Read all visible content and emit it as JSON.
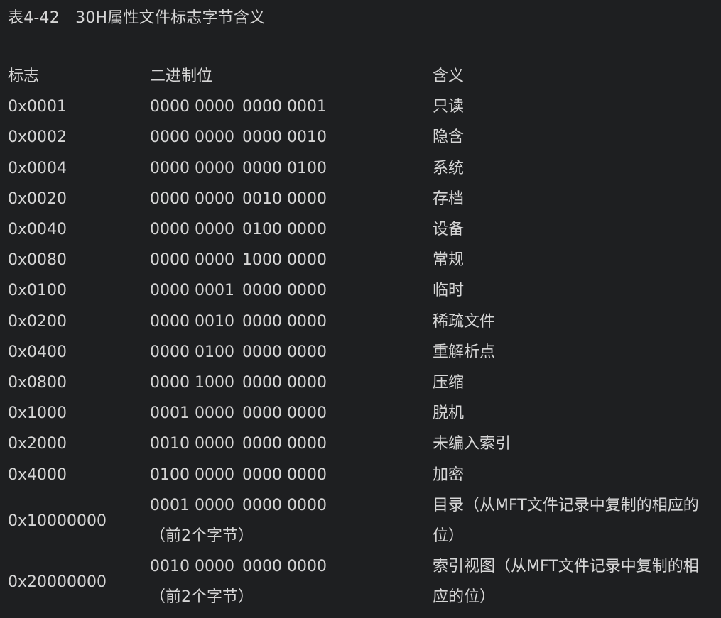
{
  "caption": "表4-42　30H属性文件标志字节含义",
  "table": {
    "headers": [
      "标志",
      "二进制位",
      "含义"
    ],
    "rows": [
      {
        "flag": "0x0001",
        "bin_hi": "0000 0000",
        "bin_lo": "0000 0001",
        "meaning": "只读"
      },
      {
        "flag": "0x0002",
        "bin_hi": "0000 0000",
        "bin_lo": "0000 0010",
        "meaning": "隐含"
      },
      {
        "flag": "0x0004",
        "bin_hi": "0000 0000",
        "bin_lo": "0000 0100",
        "meaning": "系统"
      },
      {
        "flag": "0x0020",
        "bin_hi": "0000 0000",
        "bin_lo": "0010 0000",
        "meaning": "存档"
      },
      {
        "flag": "0x0040",
        "bin_hi": "0000 0000",
        "bin_lo": "0100 0000",
        "meaning": "设备"
      },
      {
        "flag": "0x0080",
        "bin_hi": "0000 0000",
        "bin_lo": "1000 0000",
        "meaning": "常规"
      },
      {
        "flag": "0x0100",
        "bin_hi": "0000 0001",
        "bin_lo": "0000 0000",
        "meaning": "临时"
      },
      {
        "flag": "0x0200",
        "bin_hi": "0000 0010",
        "bin_lo": "0000 0000",
        "meaning": "稀疏文件"
      },
      {
        "flag": "0x0400",
        "bin_hi": "0000 0100",
        "bin_lo": "0000 0000",
        "meaning": "重解析点"
      },
      {
        "flag": "0x0800",
        "bin_hi": "0000 1000",
        "bin_lo": "0000 0000",
        "meaning": "压缩"
      },
      {
        "flag": "0x1000",
        "bin_hi": "0001 0000",
        "bin_lo": "0000 0000",
        "meaning": "脱机"
      },
      {
        "flag": "0x2000",
        "bin_hi": "0010 0000",
        "bin_lo": "0000 0000",
        "meaning": "未编入索引"
      },
      {
        "flag": "0x4000",
        "bin_hi": "0100 0000",
        "bin_lo": "0000 0000",
        "meaning": "加密"
      }
    ],
    "tall_rows": [
      {
        "flag": "0x10000000",
        "bin_hi": "0001 0000",
        "bin_lo": "0000 0000",
        "bin_note": "（前2个字节）",
        "meaning": "目录（从MFT文件记录中复制的相应的位）"
      },
      {
        "flag": "0x20000000",
        "bin_hi": "0010 0000",
        "bin_lo": "0000 0000",
        "bin_note": "（前2个字节）",
        "meaning": "索引视图（从MFT文件记录中复制的相应的位）"
      }
    ]
  }
}
